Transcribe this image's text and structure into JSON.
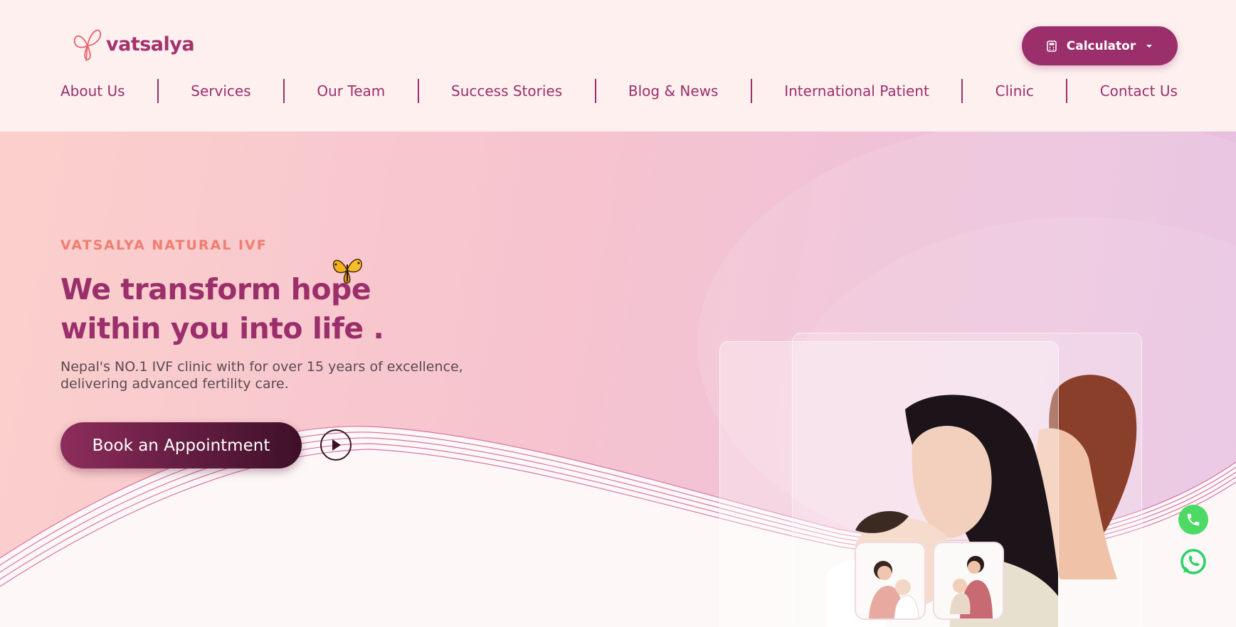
{
  "brand": {
    "name": "vatsalya",
    "primary_color": "#9b2f6b",
    "accent_color": "#ef7e6f"
  },
  "header": {
    "calculator_label": "Calculator",
    "calculator_icon": "calculator-icon",
    "nav": [
      {
        "label": "About Us"
      },
      {
        "label": "Services"
      },
      {
        "label": "Our Team"
      },
      {
        "label": "Success Stories"
      },
      {
        "label": "Blog & News"
      },
      {
        "label": "International Patient"
      },
      {
        "label": "Clinic"
      },
      {
        "label": "Contact Us"
      }
    ]
  },
  "hero": {
    "eyebrow": "VATSALYA NATURAL IVF",
    "headline_line1": "We transform hope",
    "headline_line2": "within you into life .",
    "subtext": "Nepal's NO.1 IVF clinic with for over 15 years of excellence, delivering advanced fertility care.",
    "cta_label": "Book an Appointment",
    "play_icon": "play-icon"
  },
  "floating": {
    "phone_icon": "phone-icon",
    "whatsapp_icon": "whatsapp-icon",
    "phone_color": "#4cd964",
    "whatsapp_color": "#25d366"
  }
}
